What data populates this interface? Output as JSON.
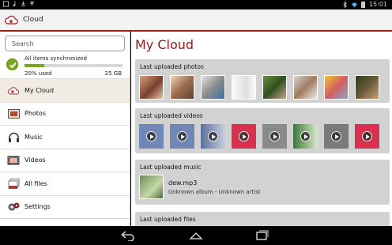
{
  "status_bar": {
    "time": "15:01"
  },
  "app_bar": {
    "title": "Cloud"
  },
  "sidebar": {
    "search_placeholder": "Search",
    "sync_status": "All items synchronized",
    "used_percent": 20,
    "used_label": "20% used",
    "capacity": "25 GB",
    "items": [
      {
        "label": "My Cloud",
        "icon": "cloud-icon"
      },
      {
        "label": "Photos",
        "icon": "photo-icon"
      },
      {
        "label": "Music",
        "icon": "headphones-icon"
      },
      {
        "label": "Videos",
        "icon": "film-icon"
      },
      {
        "label": "All files",
        "icon": "files-icon"
      },
      {
        "label": "Settings",
        "icon": "gears-icon"
      }
    ]
  },
  "main": {
    "title": "My Cloud",
    "sections": {
      "photos": {
        "header": "Last uploaded photos"
      },
      "videos": {
        "header": "Last uploaded videos"
      },
      "music": {
        "header": "Last uploaded music",
        "track_name": "dew.mp3",
        "track_meta": "Unknown album - Unknown artist"
      },
      "files": {
        "header": "Last uploaded files"
      }
    }
  },
  "colors": {
    "accent": "#8e1a1a",
    "sync_green": "#7aa81a"
  }
}
